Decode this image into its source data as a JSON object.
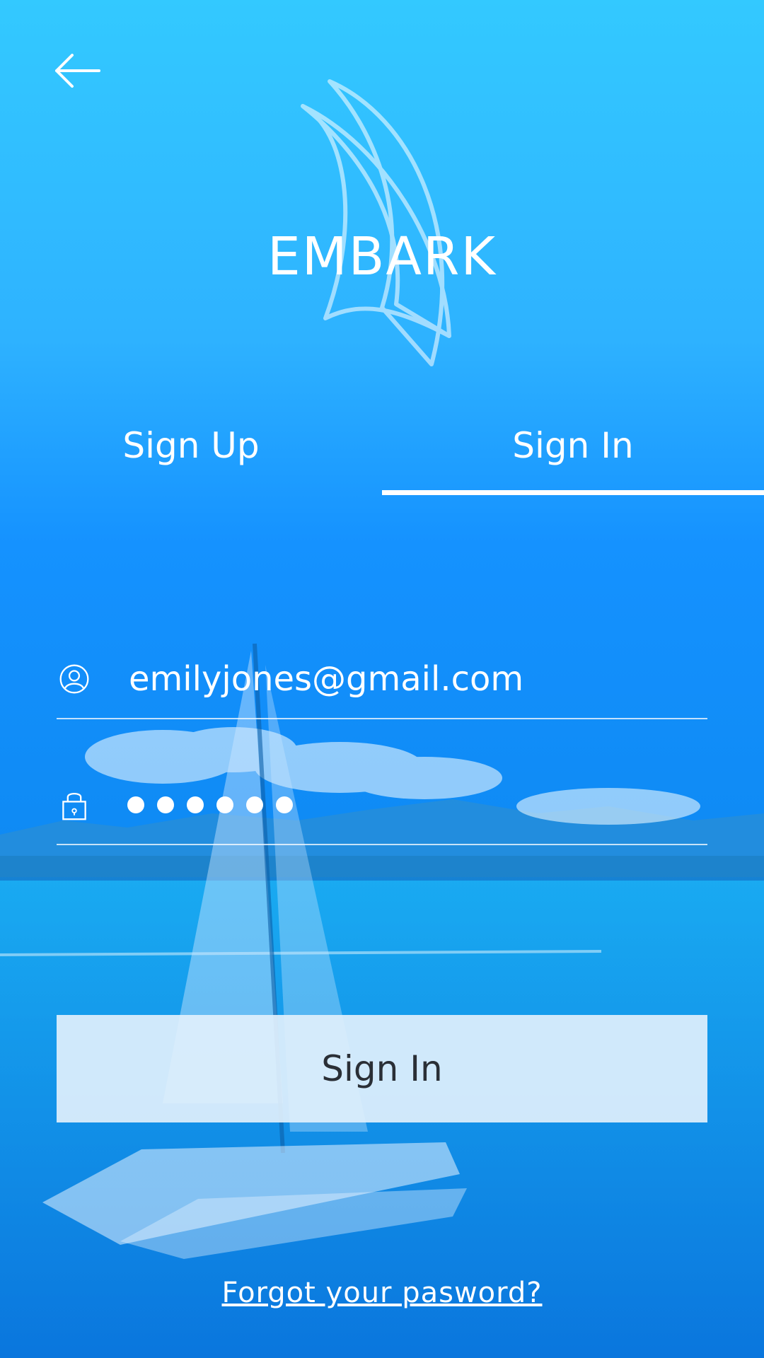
{
  "header": {
    "back_icon": "arrow-left-icon",
    "logo_icon": "sail-icon",
    "brand": "EMBARK"
  },
  "tabs": [
    {
      "label": "Sign Up",
      "active": false
    },
    {
      "label": "Sign In",
      "active": true
    }
  ],
  "form": {
    "email": {
      "icon": "user-circle-icon",
      "value": "emilyjones@gmail.com"
    },
    "password": {
      "icon": "lock-icon",
      "masked_length": 6
    },
    "submit_label": "Sign In",
    "forgot_label": "Forgot your pasword?"
  },
  "colors": {
    "background_top": "#33c9ff",
    "background_bottom": "#0a7fe6",
    "button_bg": "#e1f0fc",
    "button_text": "#2a2f36",
    "text": "#ffffff"
  }
}
